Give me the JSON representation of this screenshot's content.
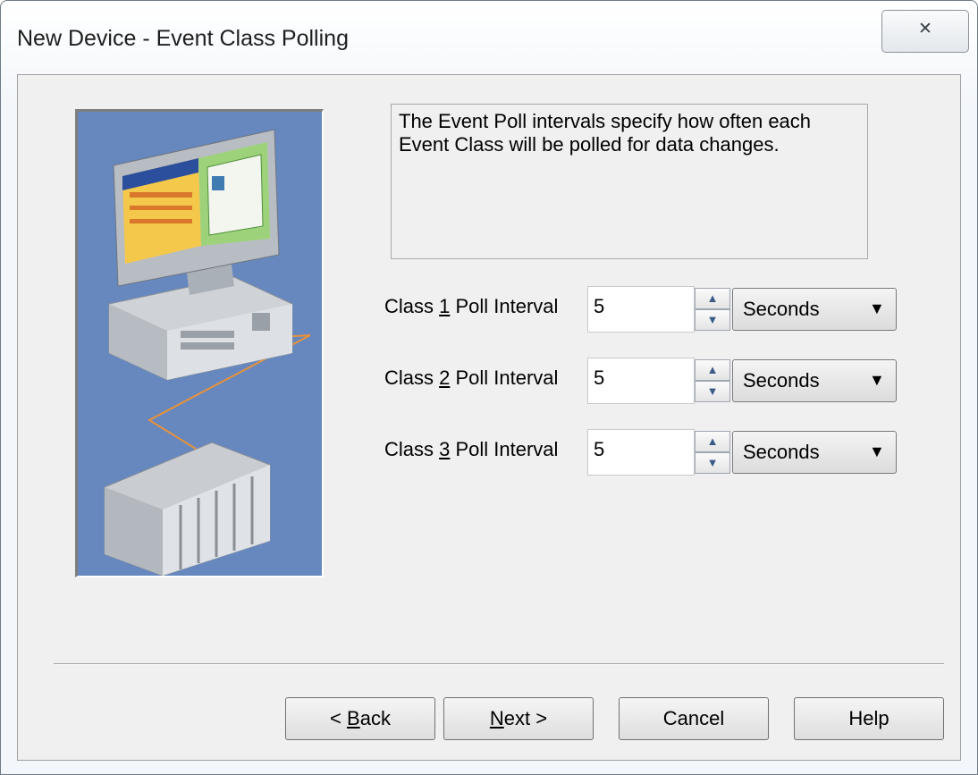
{
  "window": {
    "title": "New Device - Event Class Polling",
    "close_glyph": "✕"
  },
  "description": "The Event Poll intervals specify how often each Event Class will be polled for data changes.",
  "rows": [
    {
      "label_pre": "Class ",
      "label_key": "1",
      "label_post": " Poll Interval",
      "value": "5",
      "unit": "Seconds"
    },
    {
      "label_pre": "Class ",
      "label_key": "2",
      "label_post": " Poll Interval",
      "value": "5",
      "unit": "Seconds"
    },
    {
      "label_pre": "Class ",
      "label_key": "3",
      "label_post": " Poll Interval",
      "value": "5",
      "unit": "Seconds"
    }
  ],
  "spin_glyphs": {
    "up": "▲",
    "down": "▼"
  },
  "dropdown_glyph": "▼",
  "buttons": {
    "back": {
      "pre": "< ",
      "key": "B",
      "post": "ack"
    },
    "next": {
      "key": "N",
      "post": "ext >"
    },
    "cancel": "Cancel",
    "help": "Help"
  },
  "colors": {
    "illustration_bg": "#6688bf",
    "dialog_bg": "#f0f0f0"
  }
}
